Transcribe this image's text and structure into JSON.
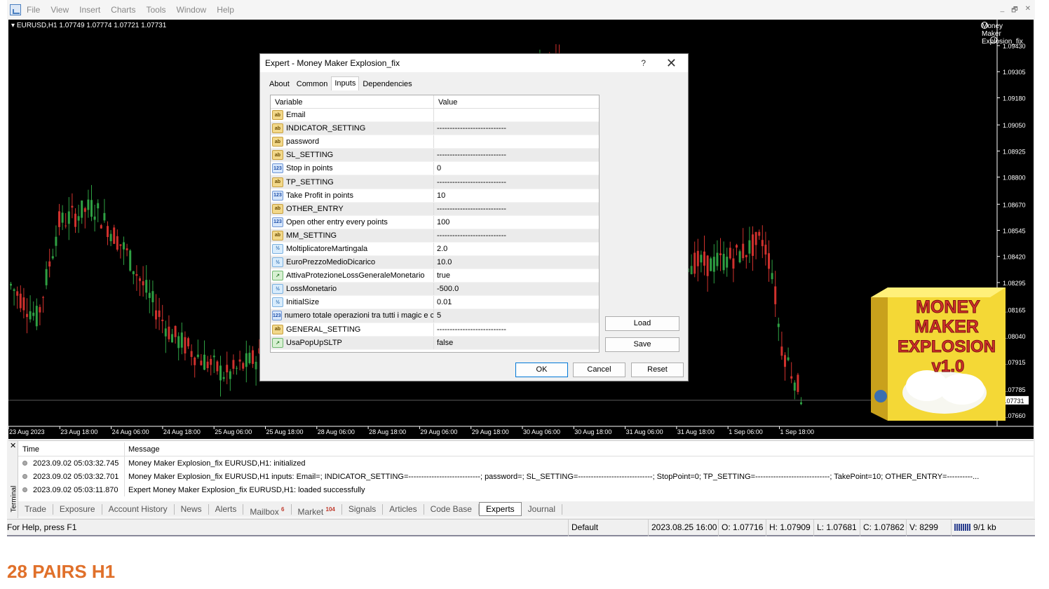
{
  "menu": [
    "File",
    "View",
    "Insert",
    "Charts",
    "Tools",
    "Window",
    "Help"
  ],
  "window_controls": [
    "_",
    "🗗",
    "✕"
  ],
  "chart": {
    "symbol_info": "EURUSD,H1  1.07749 1.07774 1.07721 1.07731",
    "ea_label": "Money Maker Explosion_fix",
    "price_levels": [
      "1.09430",
      "1.09305",
      "1.09180",
      "1.09050",
      "1.08925",
      "1.08800",
      "1.08670",
      "1.08545",
      "1.08420",
      "1.08295",
      "1.08165",
      "1.08040",
      "1.07915",
      "1.07785",
      "1.07731",
      "1.07660"
    ],
    "current_price": "1.07731",
    "time_labels": [
      "23 Aug 2023",
      "23 Aug 18:00",
      "24 Aug 06:00",
      "24 Aug 18:00",
      "25 Aug 06:00",
      "25 Aug 18:00",
      "28 Aug 06:00",
      "28 Aug 18:00",
      "29 Aug 06:00",
      "29 Aug 18:00",
      "30 Aug 06:00",
      "30 Aug 18:00",
      "31 Aug 06:00",
      "31 Aug 18:00",
      "1 Sep 06:00",
      "1 Sep 18:00"
    ],
    "colors": {
      "bull": "#2ea043",
      "bear": "#d0312d",
      "background": "#000000",
      "axis_text": "#ffffff"
    }
  },
  "product": {
    "line1": "MONEY",
    "line2": "MAKER",
    "line3": "EXPLOSION",
    "line4": "v1.0"
  },
  "dialog": {
    "title": "Expert - Money Maker Explosion_fix",
    "help": "?",
    "close": "✕",
    "tabs": [
      "About",
      "Common",
      "Inputs",
      "Dependencies"
    ],
    "active_tab": "Inputs",
    "col_variable": "Variable",
    "col_value": "Value",
    "rows": [
      {
        "icon": "ab",
        "name": "Email",
        "value": "",
        "sect": false
      },
      {
        "icon": "ab",
        "name": "INDICATOR_SETTING",
        "value": "---------------------------",
        "sect": true
      },
      {
        "icon": "ab",
        "name": "password",
        "value": "",
        "sect": false
      },
      {
        "icon": "ab",
        "name": "SL_SETTING",
        "value": "---------------------------",
        "sect": true
      },
      {
        "icon": "123",
        "name": "Stop in points",
        "value": "0",
        "sect": false
      },
      {
        "icon": "ab",
        "name": "TP_SETTING",
        "value": "---------------------------",
        "sect": true
      },
      {
        "icon": "123",
        "name": "Take Profit in points",
        "value": "10",
        "sect": false
      },
      {
        "icon": "ab",
        "name": "OTHER_ENTRY",
        "value": "---------------------------",
        "sect": true
      },
      {
        "icon": "123",
        "name": "Open other entry every points",
        "value": "100",
        "sect": false
      },
      {
        "icon": "ab",
        "name": "MM_SETTING",
        "value": "---------------------------",
        "sect": true
      },
      {
        "icon": "frac",
        "name": "MoltiplicatoreMartingala",
        "value": "2.0",
        "sect": false
      },
      {
        "icon": "frac",
        "name": "EuroPrezzoMedioDicarico",
        "value": "10.0",
        "sect": true
      },
      {
        "icon": "bool",
        "name": "AttivaProtezioneLossGeneraleMonetario",
        "value": "true",
        "sect": false
      },
      {
        "icon": "frac",
        "name": "LossMonetario",
        "value": "-500.0",
        "sect": true
      },
      {
        "icon": "frac",
        "name": "InitialSize",
        "value": "0.01",
        "sect": false
      },
      {
        "icon": "123",
        "name": "numero totale operazioni tra tutti i magic e co...",
        "value": "5",
        "sect": true
      },
      {
        "icon": "ab",
        "name": "GENERAL_SETTING",
        "value": "---------------------------",
        "sect": false
      },
      {
        "icon": "bool",
        "name": "UsaPopUpSLTP",
        "value": "false",
        "sect": true
      }
    ],
    "load": "Load",
    "save": "Save",
    "ok": "OK",
    "cancel": "Cancel",
    "reset": "Reset"
  },
  "terminal": {
    "label": "Terminal",
    "col_time": "Time",
    "col_message": "Message",
    "rows": [
      {
        "time": "2023.09.02 05:03:32.745",
        "msg": "Money Maker Explosion_fix EURUSD,H1: initialized"
      },
      {
        "time": "2023.09.02 05:03:32.701",
        "msg": "Money Maker Explosion_fix EURUSD,H1 inputs: Email=; INDICATOR_SETTING=----------------------------; password=; SL_SETTING=-----------------------------; StopPoint=0; TP_SETTING=-----------------------------; TakePoint=10; OTHER_ENTRY=----------..."
      },
      {
        "time": "2023.09.02 05:03:11.870",
        "msg": "Expert Money Maker Explosion_fix EURUSD,H1: loaded successfully"
      }
    ],
    "tabs": [
      {
        "label": "Trade",
        "badge": ""
      },
      {
        "label": "Exposure",
        "badge": ""
      },
      {
        "label": "Account History",
        "badge": ""
      },
      {
        "label": "News",
        "badge": ""
      },
      {
        "label": "Alerts",
        "badge": ""
      },
      {
        "label": "Mailbox",
        "badge": "6"
      },
      {
        "label": "Market",
        "badge": "104"
      },
      {
        "label": "Signals",
        "badge": ""
      },
      {
        "label": "Articles",
        "badge": ""
      },
      {
        "label": "Code Base",
        "badge": ""
      },
      {
        "label": "Experts",
        "badge": ""
      },
      {
        "label": "Journal",
        "badge": ""
      }
    ],
    "active_tab": "Experts"
  },
  "status": {
    "help": "For Help, press F1",
    "profile": "Default",
    "datetime": "2023.08.25 16:00",
    "open": "O: 1.07716",
    "high": "H: 1.07909",
    "low": "L: 1.07681",
    "close": "C: 1.07862",
    "volume": "V: 8299",
    "traffic": "9/1 kb"
  },
  "footer_title": "28 PAIRS H1"
}
